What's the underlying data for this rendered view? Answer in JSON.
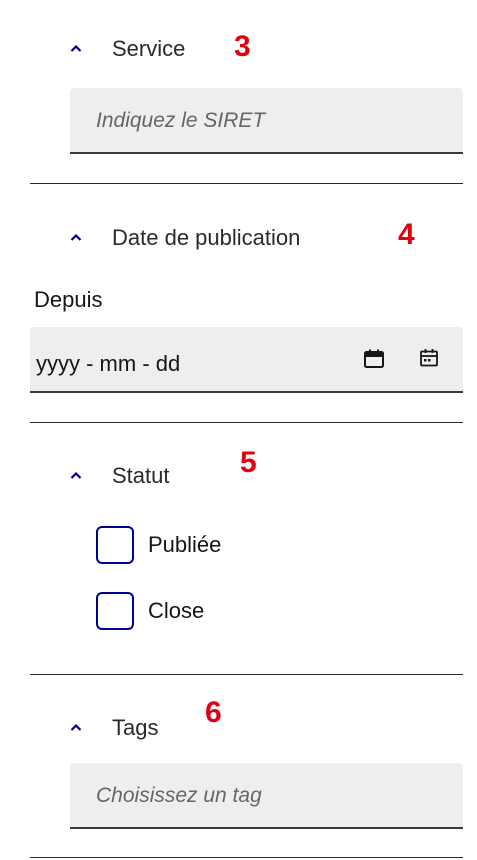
{
  "service": {
    "title": "Service",
    "marker": "3",
    "input": {
      "placeholder": "Indiquez le SIRET",
      "value": ""
    }
  },
  "date": {
    "title": "Date de publication",
    "marker": "4",
    "since_label": "Depuis",
    "input": {
      "value": "yyyy - mm - dd"
    },
    "icons": [
      "calendar-icon",
      "calendar-picker-icon"
    ]
  },
  "statut": {
    "title": "Statut",
    "marker": "5",
    "options": [
      {
        "label": "Publiée",
        "checked": false
      },
      {
        "label": "Close",
        "checked": false
      }
    ]
  },
  "tags": {
    "title": "Tags",
    "marker": "6",
    "input": {
      "placeholder": "Choisissez un tag",
      "value": ""
    }
  },
  "colors": {
    "accent": "#000091",
    "marker": "#e1000f",
    "field_bg": "#eeeeee"
  }
}
